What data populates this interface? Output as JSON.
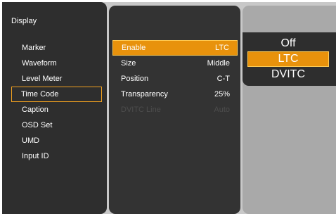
{
  "menu": {
    "title": "Display",
    "items": [
      {
        "label": "Marker"
      },
      {
        "label": "Waveform"
      },
      {
        "label": "Level Meter"
      },
      {
        "label": "Time Code"
      },
      {
        "label": "Caption"
      },
      {
        "label": "OSD Set"
      },
      {
        "label": "UMD"
      },
      {
        "label": "Input ID"
      }
    ],
    "selected_index": 3
  },
  "settings": {
    "rows": [
      {
        "label": "Enable",
        "value": "LTC"
      },
      {
        "label": "Size",
        "value": "Middle"
      },
      {
        "label": "Position",
        "value": "C-T"
      },
      {
        "label": "Transparency",
        "value": "25%"
      },
      {
        "label": "DVITC Line",
        "value": "Auto"
      }
    ]
  },
  "options": {
    "items": [
      {
        "label": "Off"
      },
      {
        "label": "LTC"
      },
      {
        "label": "DVITC"
      }
    ],
    "selected_index": 1
  },
  "colors": {
    "accent": "#e8920c",
    "highlight_border": "#f0a020",
    "panel": "#2f2f2f",
    "disabled_text": "#4d4d4d"
  }
}
